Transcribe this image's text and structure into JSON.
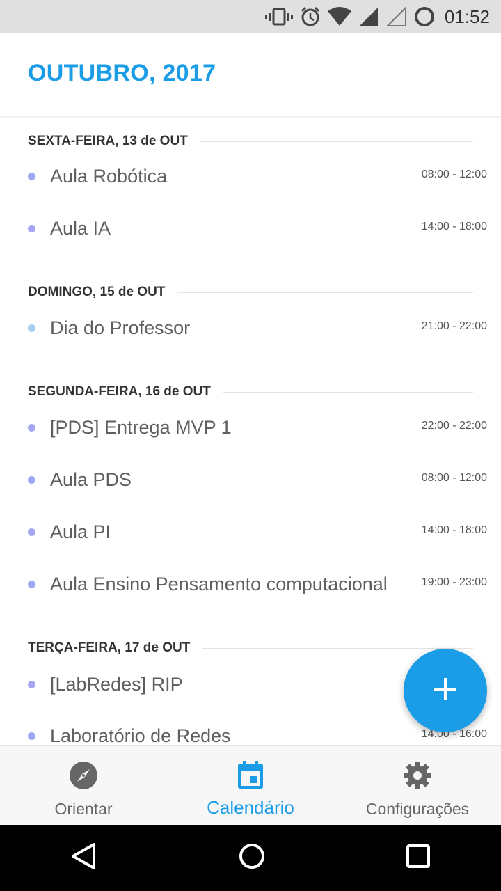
{
  "status_bar": {
    "time": "01:52",
    "icons": [
      "vibrate-icon",
      "alarm-icon",
      "wifi-icon",
      "signal-icon",
      "signal-empty-icon",
      "sync-icon"
    ]
  },
  "header": {
    "title": "OUTUBRO, 2017"
  },
  "days": [
    {
      "label": "SEXTA-FEIRA, 13 de OUT",
      "events": [
        {
          "title": "Aula Robótica",
          "time": "08:00 - 12:00",
          "color": "#a3a6f2"
        },
        {
          "title": "Aula IA",
          "time": "14:00 - 18:00",
          "color": "#a3a6f2"
        }
      ]
    },
    {
      "label": "DOMINGO, 15 de OUT",
      "events": [
        {
          "title": "Dia do Professor",
          "time": "21:00 - 22:00",
          "color": "#a9cdee"
        }
      ]
    },
    {
      "label": "SEGUNDA-FEIRA, 16 de OUT",
      "events": [
        {
          "title": "[PDS] Entrega MVP 1",
          "time": "22:00 - 22:00",
          "color": "#a3a6f2"
        },
        {
          "title": "Aula PDS",
          "time": "08:00 - 12:00",
          "color": "#a3a6f2"
        },
        {
          "title": "Aula PI",
          "time": "14:00 - 18:00",
          "color": "#a3a6f2"
        },
        {
          "title": "Aula Ensino Pensamento computacional",
          "time": "19:00 - 23:00",
          "color": "#a3a6f2"
        }
      ]
    },
    {
      "label": "TERÇA-FEIRA, 17 de OUT",
      "events": [
        {
          "title": "[LabRedes] RIP",
          "time": "",
          "color": "#a3a6f2"
        },
        {
          "title": "Laboratório de Redes",
          "time": "14:00 - 16:00",
          "color": "#a3a6f2"
        }
      ]
    }
  ],
  "fab": {
    "icon": "plus-icon"
  },
  "bottom_nav": {
    "items": [
      {
        "label": "Orientar",
        "icon": "compass-icon",
        "active": false
      },
      {
        "label": "Calendário",
        "icon": "calendar-icon",
        "active": true
      },
      {
        "label": "Configurações",
        "icon": "gear-icon",
        "active": false
      }
    ]
  },
  "system_nav": {
    "icons": [
      "back-icon",
      "home-icon",
      "recents-icon"
    ]
  },
  "colors": {
    "accent": "#1a9de6",
    "event_dot": "#a3a6f2",
    "event_dot_alt": "#a9cdee"
  }
}
